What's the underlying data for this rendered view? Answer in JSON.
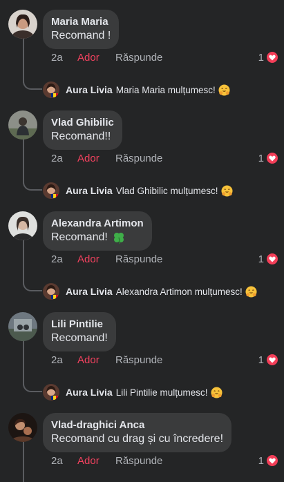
{
  "comments": [
    {
      "author": "Maria Maria",
      "text": "Recomand !",
      "time": "2a",
      "like": "Ador",
      "reply": "Răspunde",
      "reaction_count": "1",
      "reply_author": "Aura Livia",
      "reply_text": "Maria Maria mulțumesc!"
    },
    {
      "author": "Vlad Ghibilic",
      "text": "Recomand!!",
      "time": "2a",
      "like": "Ador",
      "reply": "Răspunde",
      "reaction_count": "1",
      "reply_author": "Aura Livia",
      "reply_text": "Vlad Ghibilic mulțumesc!"
    },
    {
      "author": "Alexandra Artimon",
      "text": "Recomand!",
      "time": "2a",
      "like": "Ador",
      "reply": "Răspunde",
      "reaction_count": "1",
      "reply_author": "Aura Livia",
      "reply_text": "Alexandra Artimon mulțumesc!"
    },
    {
      "author": "Lili Pintilie",
      "text": "Recomand!",
      "time": "2a",
      "like": "Ador",
      "reply": "Răspunde",
      "reaction_count": "1",
      "reply_author": "Aura Livia",
      "reply_text": "Lili Pintilie mulțumesc!"
    },
    {
      "author": "Vlad-draghici Anca",
      "text": "Recomand cu drag și cu încredere!",
      "time": "2a",
      "like": "Ador",
      "reply": "Răspunde",
      "reaction_count": "1"
    }
  ],
  "icons": {
    "reaction": "heart-icon",
    "reply_emoji": "hugging-face-icon",
    "clover": "four-leaf-clover-icon"
  },
  "colors": {
    "background": "#242526",
    "bubble": "#3a3b3c",
    "like_active": "#f3425f",
    "muted": "#b0b3b8"
  }
}
